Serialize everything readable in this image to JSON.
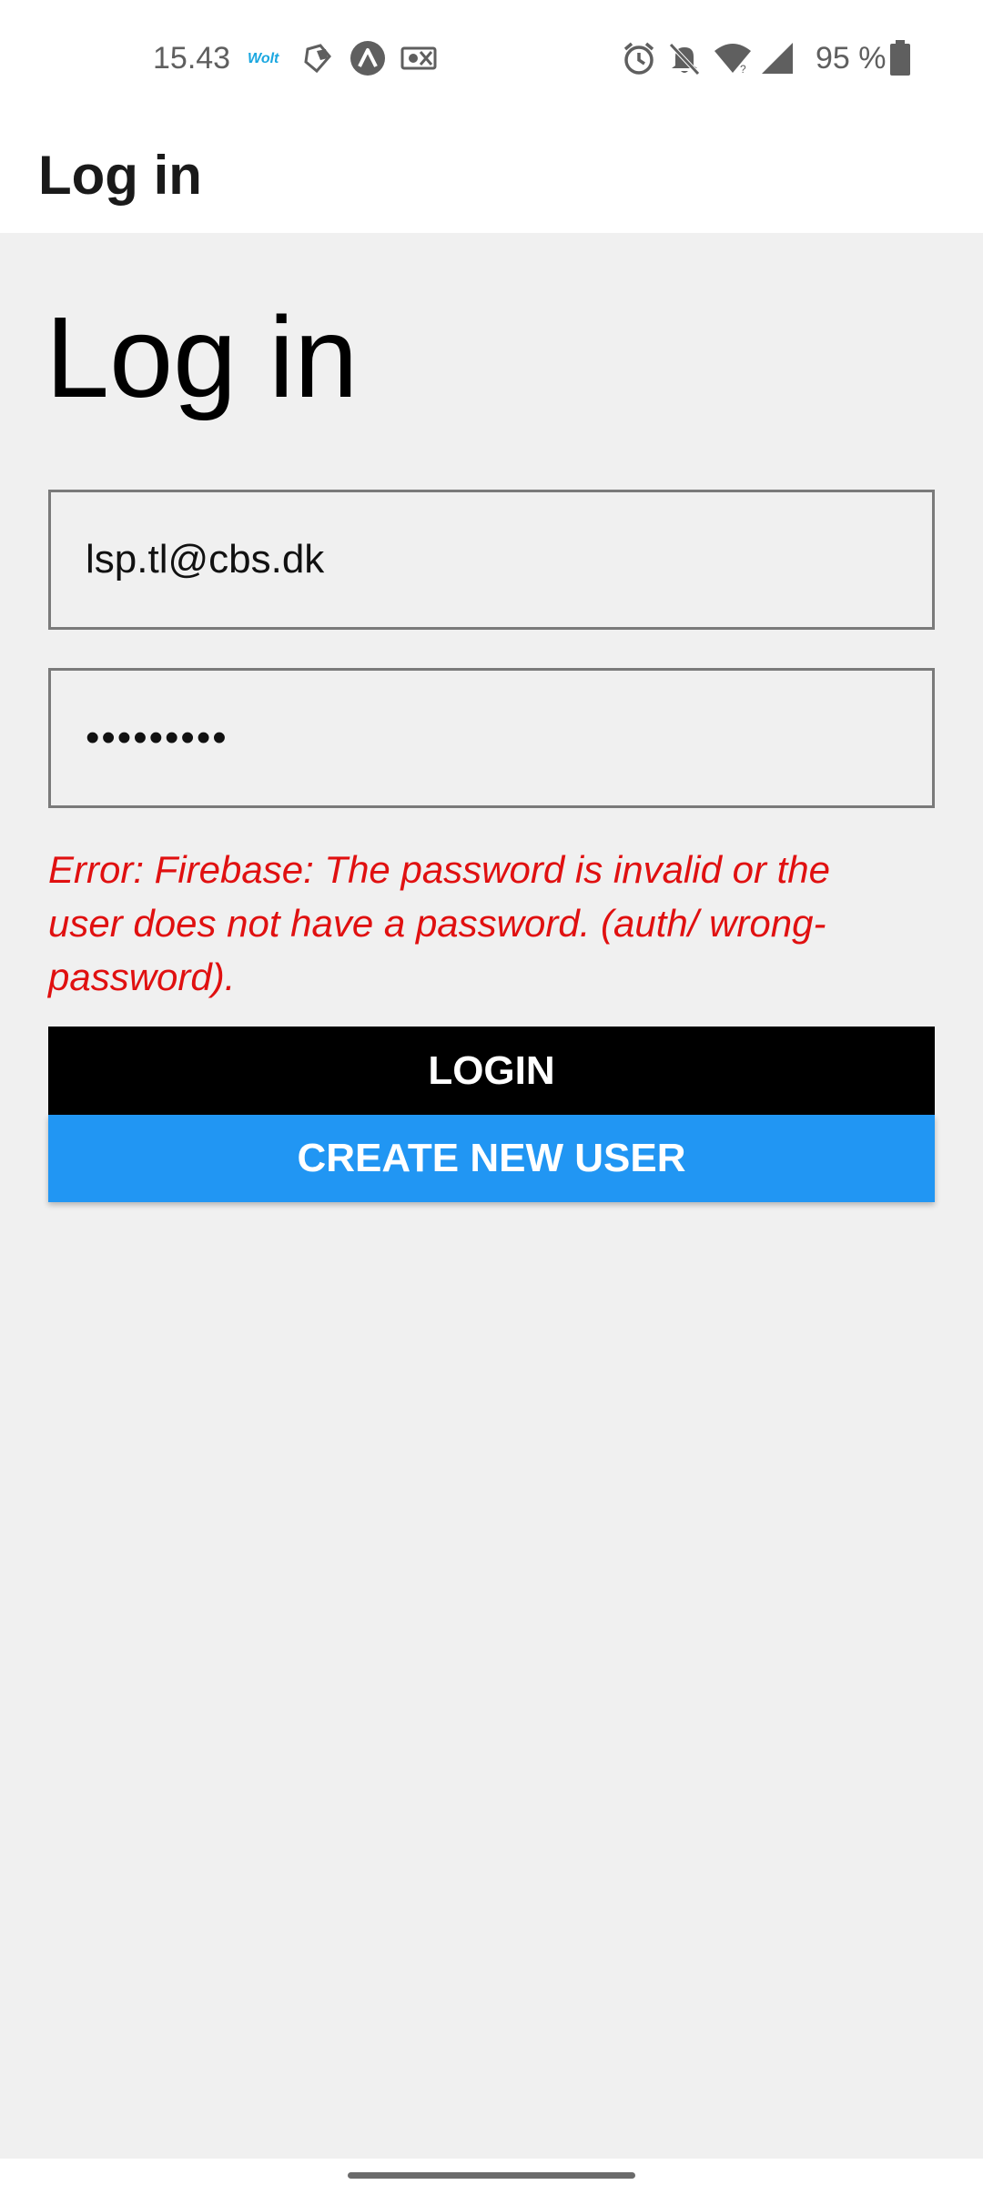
{
  "status_bar": {
    "time": "15.43",
    "notification_icons": [
      "wolt-icon",
      "tag-icon",
      "expo-icon",
      "money-icon"
    ],
    "system_icons": [
      "alarm-icon",
      "bell-off-icon",
      "wifi-icon",
      "cellular-icon"
    ],
    "battery_percent": "95 %",
    "battery_level": 0.95
  },
  "header": {
    "title": "Log in"
  },
  "main": {
    "heading": "Log in",
    "email": {
      "value": "lsp.tl@cbs.dk"
    },
    "password": {
      "value": "•••••••••"
    },
    "error": "Error: Firebase: The password is invalid or the user does not have a password. (auth/ wrong-password).",
    "login_label": "LOGIN",
    "create_user_label": "CREATE NEW USER"
  },
  "colors": {
    "error": "#e01010",
    "login_bg": "#000000",
    "create_bg": "#2196f3"
  }
}
